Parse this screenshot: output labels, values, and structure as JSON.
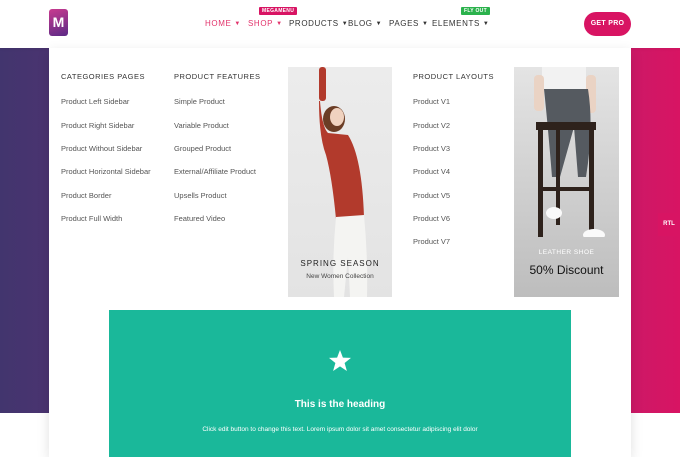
{
  "nav": {
    "logo_letter": "M",
    "items": [
      {
        "label": "HOME",
        "badge": null
      },
      {
        "label": "SHOP",
        "badge": "MEGAMENU"
      },
      {
        "label": "PRODUCTS",
        "badge": null
      },
      {
        "label": "BLOG",
        "badge": null
      },
      {
        "label": "PAGES",
        "badge": null
      },
      {
        "label": "ELEMENTS",
        "badge": "FLY OUT"
      }
    ],
    "cta": "GET PRO"
  },
  "megamenu": {
    "col1": {
      "title": "CATEGORIES PAGES",
      "links": [
        "Product Left Sidebar",
        "Product Right Sidebar",
        "Product Without Sidebar",
        "Product Horizontal Sidebar",
        "Product Border",
        "Product Full Width"
      ]
    },
    "col2": {
      "title": "PRODUCT FEATURES",
      "links": [
        "Simple Product",
        "Variable Product",
        "Grouped Product",
        "External/Affiliate Product",
        "Upsells Product",
        "Featured Video"
      ]
    },
    "promo1": {
      "title": "SPRING SEASON",
      "subtitle": "New Women Collection"
    },
    "col3": {
      "title": "PRODUCT LAYOUTS",
      "links": [
        "Product V1",
        "Product V2",
        "Product V3",
        "Product V4",
        "Product V5",
        "Product V6",
        "Product V7"
      ]
    },
    "promo2": {
      "subtitle": "LEATHER SHOE",
      "title": "50% Discount"
    },
    "box": {
      "heading": "This is the heading",
      "text": "Click edit button to change this text. Lorem ipsum dolor sit amet consectetur adipiscing elit dolor"
    }
  },
  "rtl_label": "RTL",
  "colors": {
    "accent": "#e2336b",
    "cta": "#d81463",
    "teal": "#1ab89a",
    "badge_megamenu": "#d81463",
    "badge_flyout": "#2bb24c"
  }
}
